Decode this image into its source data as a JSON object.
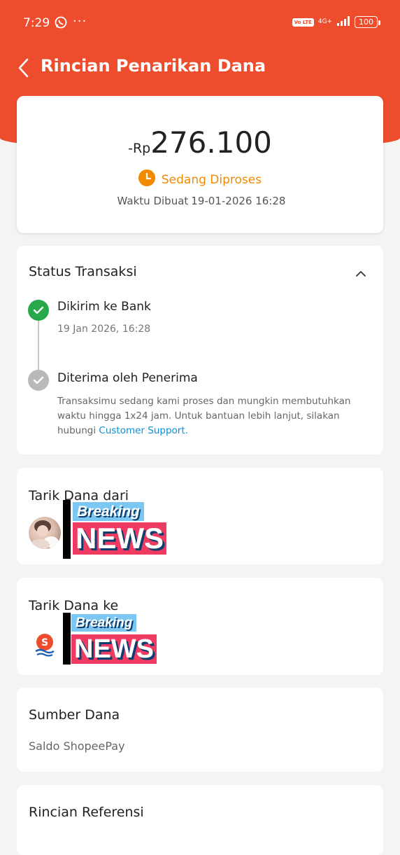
{
  "status_bar": {
    "time": "7:29",
    "network_badge": "Vo LTE",
    "network_gen": "4G+",
    "battery": "100"
  },
  "header": {
    "title": "Rincian Penarikan Dana"
  },
  "amount_card": {
    "prefix": "-Rp",
    "amount": "276.100",
    "status": "Sedang Diproses",
    "created_label": "Waktu Dibuat",
    "created_value": "19-01-2026 16:28"
  },
  "transaction_status": {
    "title": "Status Transaksi",
    "steps": [
      {
        "title": "Dikirim ke Bank",
        "time": "19 Jan 2026, 16:28"
      },
      {
        "title": "Diterima oleh Penerima",
        "description": "Transaksimu sedang kami proses dan mungkin membutuhkan waktu hingga 1x24 jam. Untuk bantuan lebih lanjut, silakan hubungi ",
        "link": "Customer Support."
      }
    ]
  },
  "withdraw_from": {
    "title": "Tarik Dana dari",
    "overlay_top": "Breaking",
    "overlay_bottom": "NEWS"
  },
  "withdraw_to": {
    "title": "Tarik Dana ke",
    "overlay_top": "Breaking",
    "overlay_bottom": "NEWS"
  },
  "source": {
    "title": "Sumber Dana",
    "value": "Saldo ShopeePay"
  },
  "reference": {
    "title": "Rincian Referensi"
  },
  "colors": {
    "brand": "#ee4d2d",
    "processing": "#f18a00",
    "success": "#27a84a",
    "link": "#0a8fd8"
  }
}
